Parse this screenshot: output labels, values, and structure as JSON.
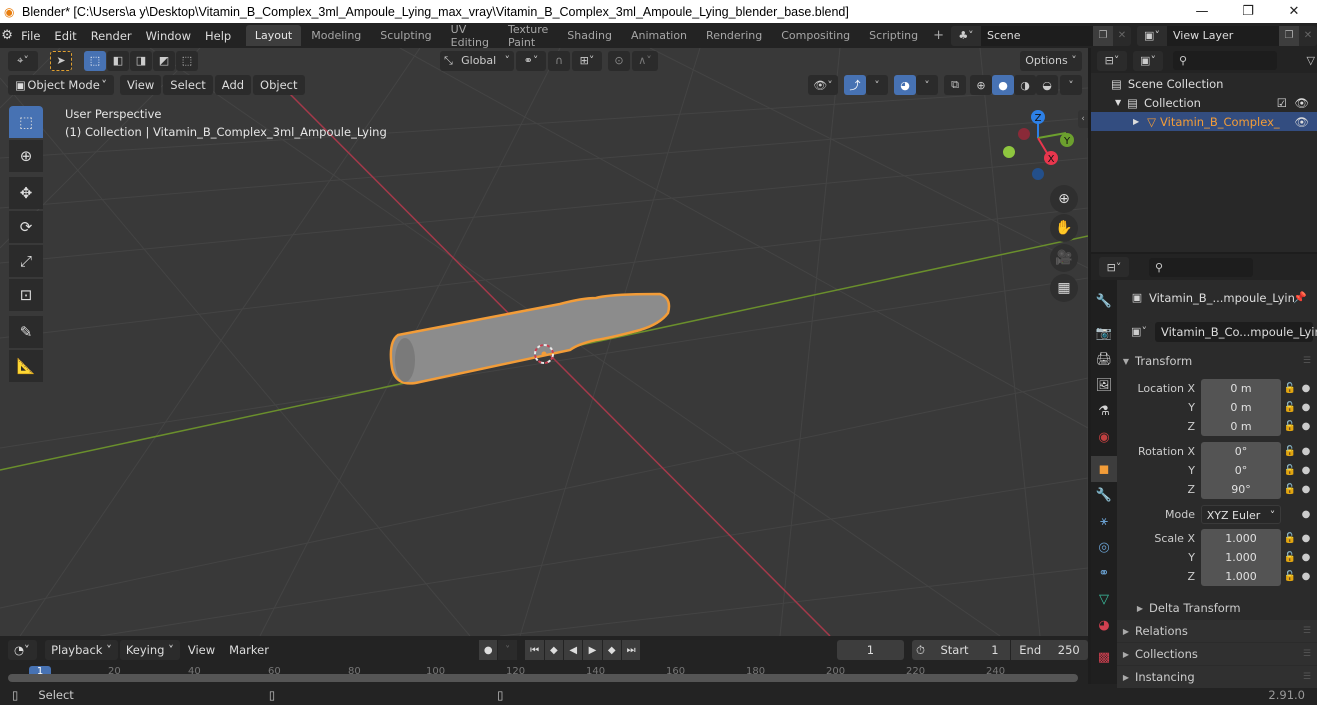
{
  "titlebar": {
    "title": "Blender* [C:\\Users\\a y\\Desktop\\Vitamin_B_Complex_3ml_Ampoule_Lying_max_vray\\Vitamin_B_Complex_3ml_Ampoule_Lying_blender_base.blend]",
    "minimize": "—",
    "restore": "❐",
    "close": "✕"
  },
  "menubar": {
    "items": [
      "File",
      "Edit",
      "Render",
      "Window",
      "Help"
    ]
  },
  "workspaces": [
    "Layout",
    "Modeling",
    "Sculpting",
    "UV Editing",
    "Texture Paint",
    "Shading",
    "Animation",
    "Rendering",
    "Compositing",
    "Scripting"
  ],
  "active_workspace": "Layout",
  "scene": {
    "name": "Scene"
  },
  "view_layer": {
    "name": "View Layer"
  },
  "viewport": {
    "transform_orientation": "Global",
    "options_label": "Options",
    "mode": "Object Mode",
    "menus": [
      "View",
      "Select",
      "Add",
      "Object"
    ],
    "perspective_label": "User Perspective",
    "collection_label": "(1) Collection | Vitamin_B_Complex_3ml_Ampoule_Lying",
    "gizmo": {
      "x": "X",
      "y": "Y",
      "z": "Z"
    },
    "colors": {
      "x_axis": "#b83a4a",
      "y_axis": "#6e9a2f",
      "outline": "#f29c38",
      "gizmo_x": "#e8364d",
      "gizmo_y": "#6ca02e",
      "gizmo_z": "#2d80e6"
    }
  },
  "outliner": {
    "scene_collection": "Scene Collection",
    "collection": "Collection",
    "object": "Vitamin_B_Complex_"
  },
  "properties": {
    "object_name": "Vitamin_B_...mpoule_Lyin",
    "data_name": "Vitamin_B_Co...mpoule_Lying",
    "transform_label": "Transform",
    "location": {
      "label": "Location X",
      "x": "0 m",
      "y": "0 m",
      "z": "0 m"
    },
    "rotation": {
      "label": "Rotation X",
      "x": "0°",
      "y": "0°",
      "z": "90°"
    },
    "mode_label": "Mode",
    "mode_value": "XYZ Euler",
    "scale": {
      "label": "Scale X",
      "x": "1.000",
      "y": "1.000",
      "z": "1.000"
    },
    "axis_y": "Y",
    "axis_z": "Z",
    "delta_transform": "Delta Transform",
    "relations": "Relations",
    "collections": "Collections",
    "instancing": "Instancing"
  },
  "timeline": {
    "menus": [
      "Playback",
      "Keying",
      "View",
      "Marker"
    ],
    "current_frame": "1",
    "start_label": "Start",
    "start": "1",
    "end_label": "End",
    "end": "250",
    "ticks": [
      "20",
      "40",
      "60",
      "80",
      "100",
      "120",
      "140",
      "160",
      "180",
      "200",
      "220",
      "240"
    ],
    "playhead": "1"
  },
  "statusbar": {
    "select_label": "Select",
    "version": "2.91.0"
  }
}
